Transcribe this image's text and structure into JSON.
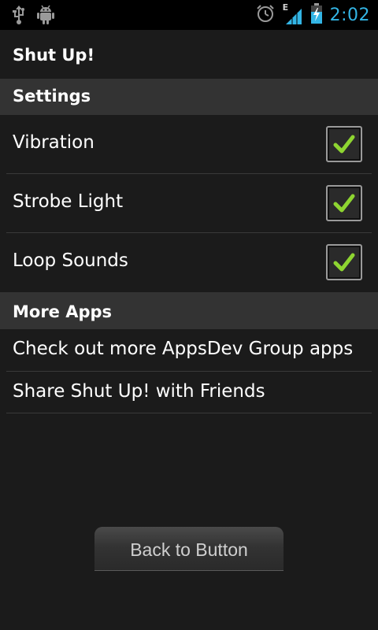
{
  "status_bar": {
    "time": "2:02",
    "network_type": "E",
    "left_icons": [
      "usb-icon",
      "android-debug-icon"
    ],
    "right_icons": [
      "alarm-icon",
      "signal-icon",
      "battery-charging-icon"
    ],
    "accent_color": "#33b5e5"
  },
  "app": {
    "title": "Shut Up!"
  },
  "settings": {
    "header": "Settings",
    "items": [
      {
        "label": "Vibration",
        "checked": true
      },
      {
        "label": "Strobe Light",
        "checked": true
      },
      {
        "label": "Loop Sounds",
        "checked": true
      }
    ]
  },
  "more_apps": {
    "header": "More Apps",
    "items": [
      {
        "label": "Check out more AppsDev Group apps"
      },
      {
        "label": "Share Shut Up! with Friends"
      }
    ]
  },
  "footer": {
    "back_button_label": "Back to Button"
  },
  "colors": {
    "background": "#1b1b1b",
    "section_header": "#333333",
    "checkmark": "#8ed531"
  }
}
